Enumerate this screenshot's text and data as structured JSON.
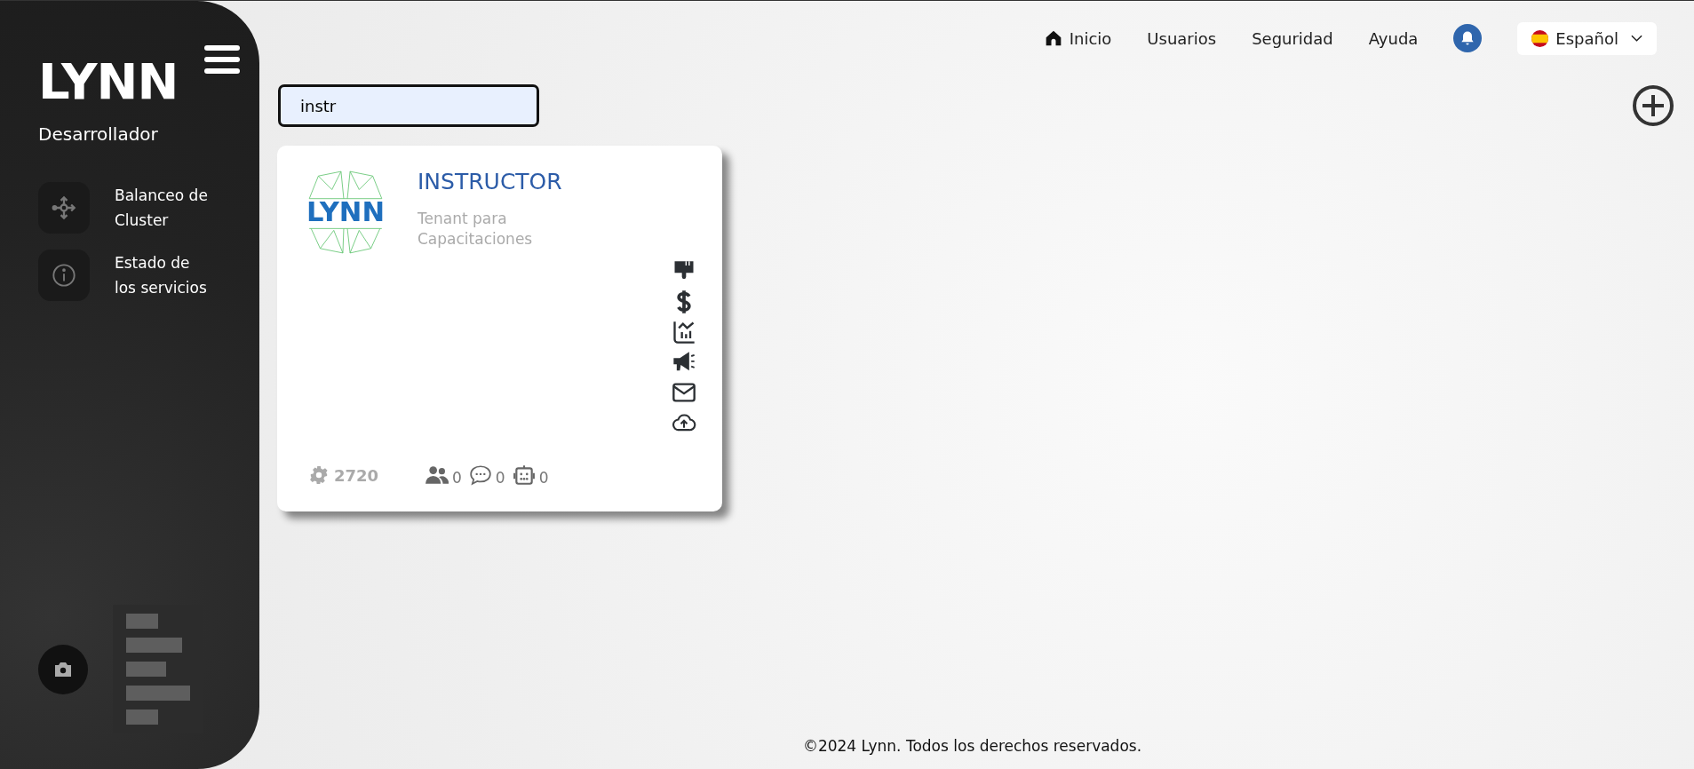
{
  "sidebar": {
    "logo": "LYNN",
    "role": "Desarrollador",
    "items": [
      {
        "kind": "cluster",
        "label": "Balanceo de Cluster"
      },
      {
        "kind": "info",
        "label": "Estado de los servicios"
      }
    ]
  },
  "topnav": {
    "links": [
      {
        "kind": "home",
        "label": "Inicio"
      },
      {
        "kind": "plain",
        "label": "Usuarios"
      },
      {
        "kind": "plain",
        "label": "Seguridad"
      },
      {
        "kind": "plain",
        "label": "Ayuda"
      }
    ],
    "language": "Español"
  },
  "search": {
    "value": "instr"
  },
  "tenants": [
    {
      "logo": "LYNN",
      "name": "INSTRUCTOR",
      "description": "Tenant para Capacitaciones",
      "id": "2720",
      "actions": [
        {
          "kind": "brush"
        },
        {
          "kind": "dollar"
        },
        {
          "kind": "chart"
        },
        {
          "kind": "megaphone"
        },
        {
          "kind": "mail"
        },
        {
          "kind": "upload"
        }
      ],
      "stats": [
        {
          "kind": "users",
          "value": "0"
        },
        {
          "kind": "chat",
          "value": "0"
        },
        {
          "kind": "bot",
          "value": "0"
        }
      ]
    }
  ],
  "footer": "©2024 Lynn. Todos los derechos reservados."
}
